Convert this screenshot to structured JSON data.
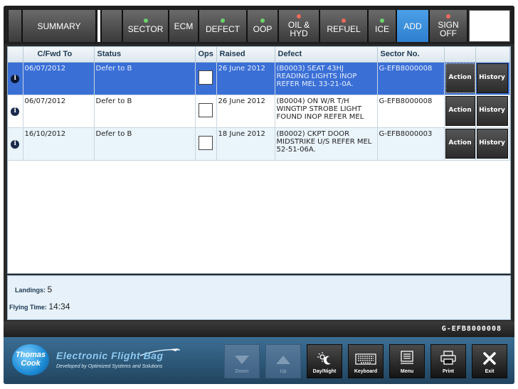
{
  "tabs": [
    {
      "label": "SUMMARY",
      "dot": "none"
    },
    {
      "label": "SECTOR",
      "dot": "green"
    },
    {
      "label": "ECM",
      "dot": "none"
    },
    {
      "label": "DEFECT",
      "dot": "green"
    },
    {
      "label": "OOP",
      "dot": "green"
    },
    {
      "label": "OIL & HYD",
      "dot": "red"
    },
    {
      "label": "REFUEL",
      "dot": "red"
    },
    {
      "label": "ICE",
      "dot": "green"
    },
    {
      "label": "ADD",
      "dot": "none"
    },
    {
      "label": "SIGN OFF",
      "dot": "red"
    }
  ],
  "table": {
    "columns": [
      "",
      "C/Fwd To",
      "Status",
      "Ops",
      "Raised",
      "Defect",
      "Sector No.",
      "",
      ""
    ],
    "rows": [
      {
        "cfwd": "06/07/2012",
        "status": "Defer to B",
        "raised": "26 June 2012",
        "defect": "(B0003) SEAT 43HJ READING LIGHTS INOP REFER MEL 33-21-0A.",
        "sector": "G-EFB8000008",
        "action": "Action",
        "history": "History",
        "selected": true
      },
      {
        "cfwd": "06/07/2012",
        "status": "Defer to B",
        "raised": "26 June 2012",
        "defect": "(B0004) ON W/R T/H WINGTIP STROBE LIGHT FOUND INOP REFER MEL",
        "sector": "G-EFB8000008",
        "action": "Action",
        "history": "History",
        "selected": false
      },
      {
        "cfwd": "16/10/2012",
        "status": "Defer to B",
        "raised": "18 June 2012",
        "defect": "(B0002) CKPT DOOR MIDSTRIKE U/S REFER MEL 52-51-06A.",
        "sector": "G-EFB8000003",
        "action": "Action",
        "history": "History",
        "selected": false
      }
    ]
  },
  "summary": {
    "landings_label": "Landings:",
    "landings_value": "5",
    "flying_label": "Flying Time:",
    "flying_value": "14:34"
  },
  "status_bar": {
    "registration": "G-EFB8000008"
  },
  "branding": {
    "logo_text": "Thomas Cook",
    "title": "Electronic Flight Bag",
    "subtitle": "Developed by Optimized Systems and Solutions"
  },
  "controls": {
    "down": "Down",
    "up": "Up",
    "daynight": "Day/Night",
    "keyboard": "Keyboard",
    "menu": "Menu",
    "print": "Print",
    "exit": "Exit"
  },
  "colors": {
    "active_tab": "#2f7fcf",
    "selected_row": "#3a6fd6",
    "status_green": "#6cd36c",
    "status_red": "#f06a5a"
  }
}
